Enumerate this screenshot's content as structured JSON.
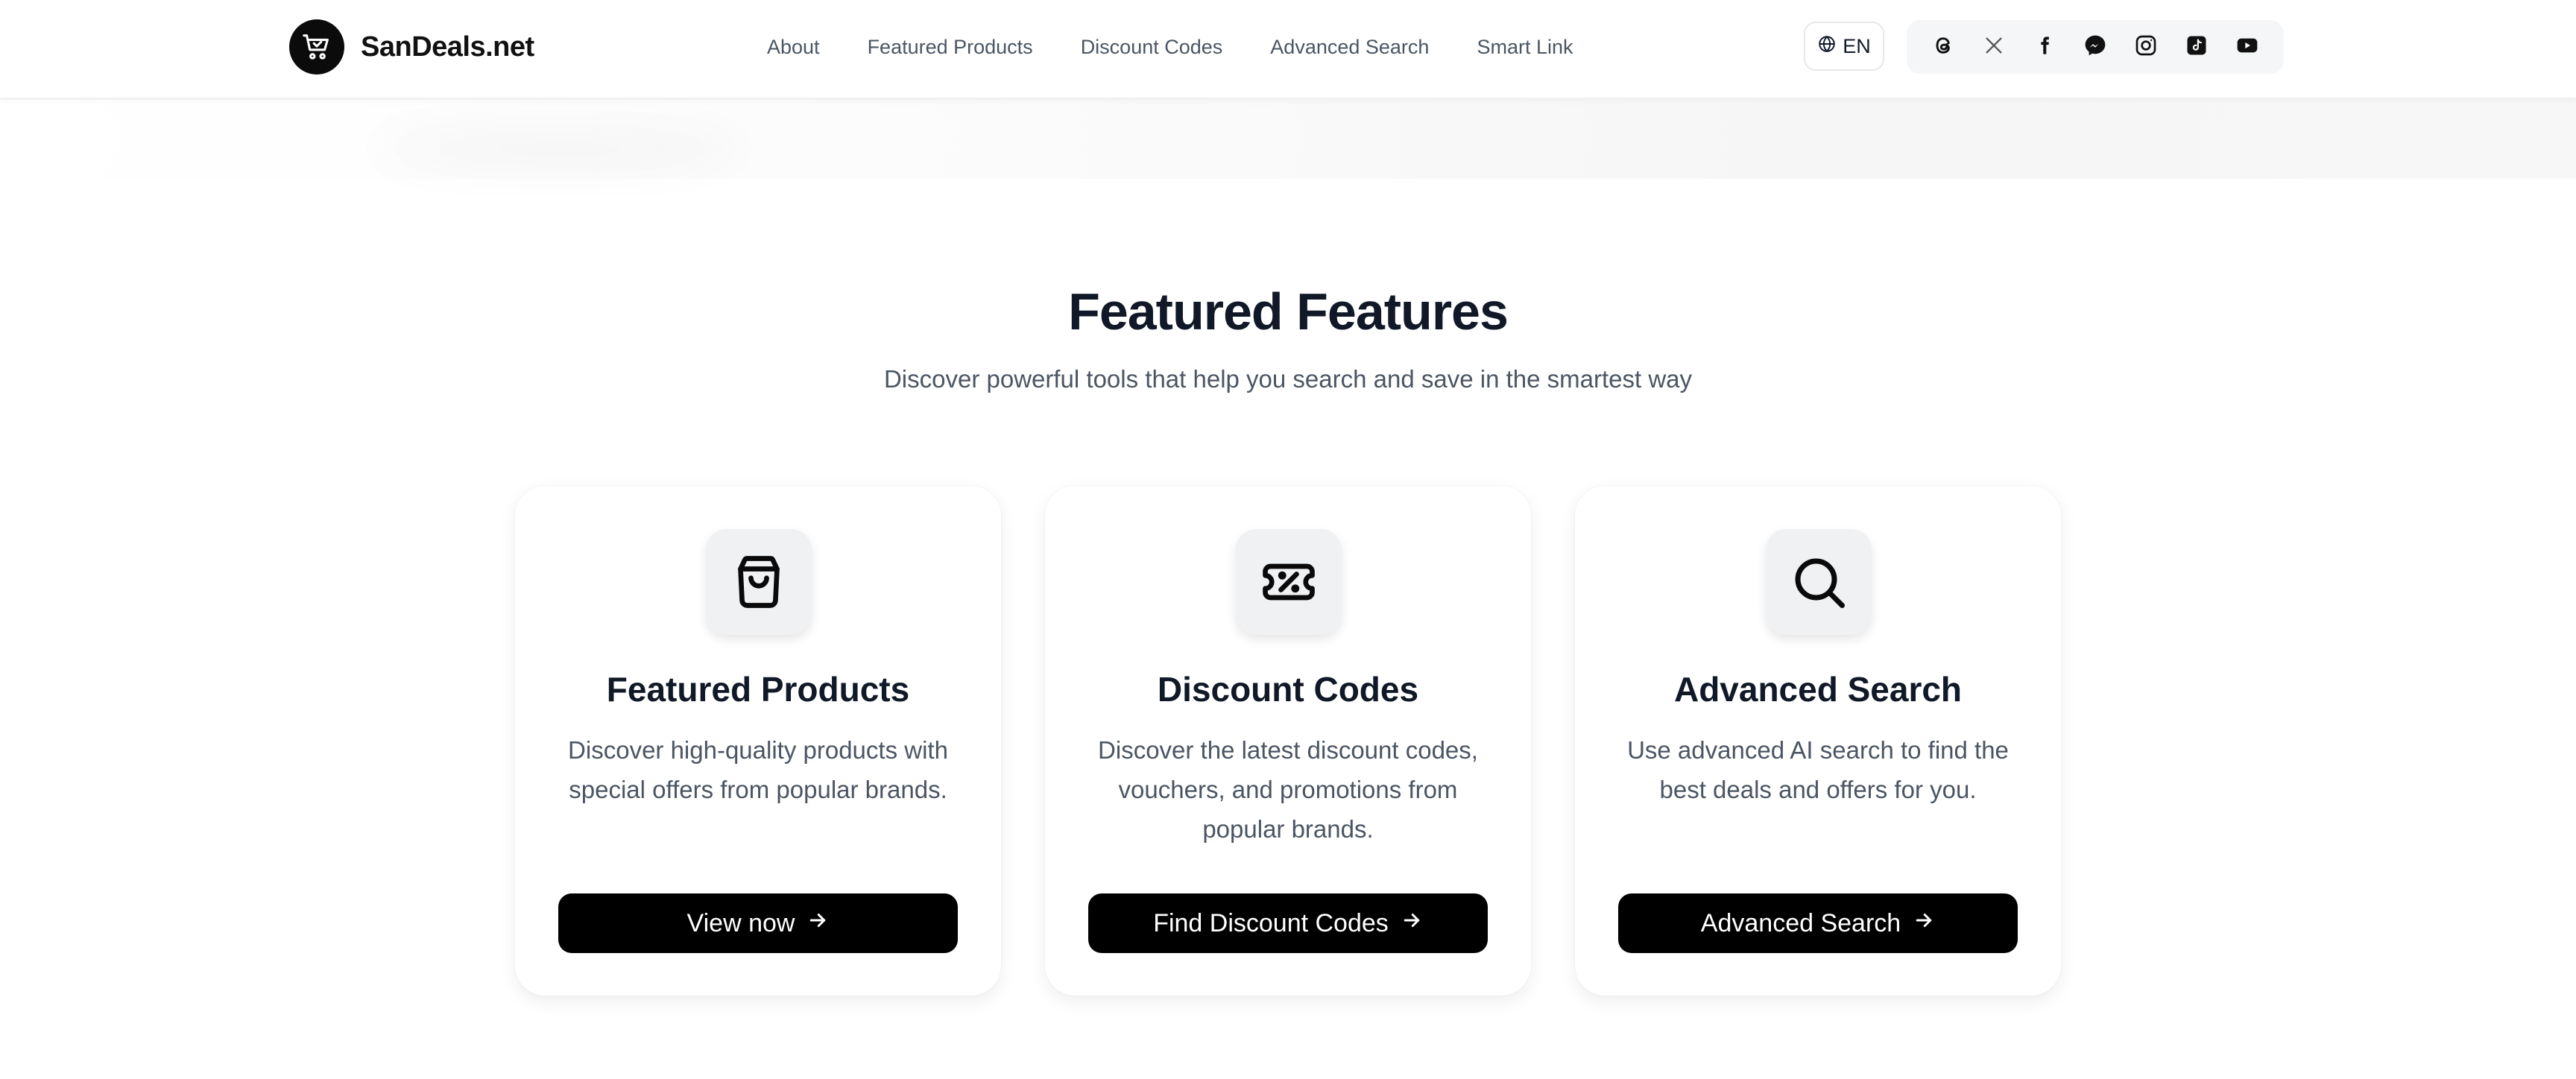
{
  "header": {
    "brand_name": "SanDeals.net",
    "nav": [
      "About",
      "Featured Products",
      "Discount Codes",
      "Advanced Search",
      "Smart Link"
    ],
    "language": "EN",
    "socials": [
      "threads-icon",
      "x-icon",
      "facebook-icon",
      "messenger-icon",
      "instagram-icon",
      "tiktok-icon",
      "youtube-icon"
    ]
  },
  "section": {
    "title": "Featured Features",
    "subtitle": "Discover powerful tools that help you search and save in the smartest way"
  },
  "cards": [
    {
      "icon": "shopping-bag-icon",
      "title": "Featured Products",
      "description": "Discover high-quality products with special offers from popular brands.",
      "button": "View now"
    },
    {
      "icon": "ticket-percent-icon",
      "title": "Discount Codes",
      "description": "Discover the latest discount codes, vouchers, and promotions from popular brands.",
      "button": "Find Discount Codes"
    },
    {
      "icon": "search-icon",
      "title": "Advanced Search",
      "description": "Use advanced AI search to find the best deals and offers for you.",
      "button": "Advanced Search"
    }
  ],
  "colors": {
    "button_bg": "#000000",
    "heading": "#111827",
    "body_text": "#4b5563",
    "icon_tile": "#f0f1f3"
  }
}
